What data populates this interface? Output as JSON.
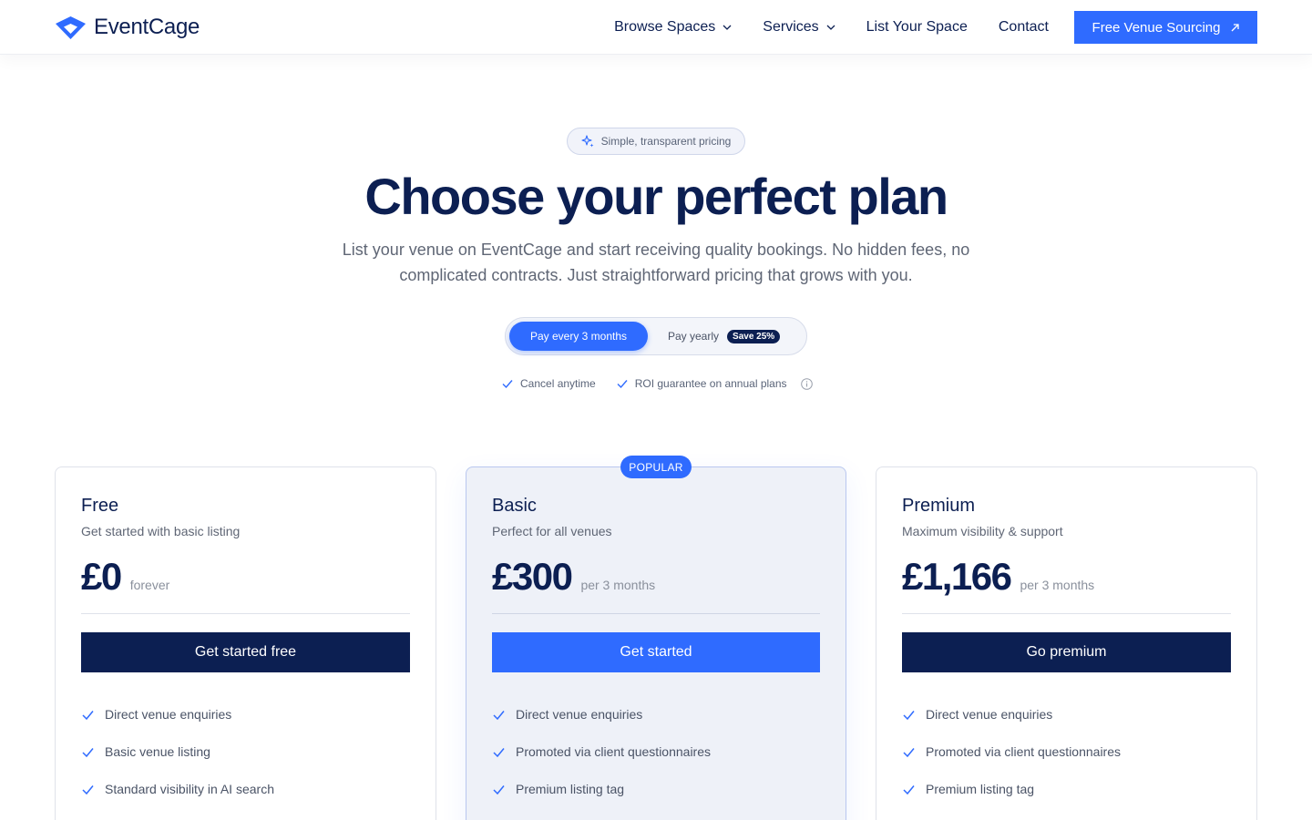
{
  "nav": {
    "brand": "EventCage",
    "items": [
      {
        "label": "Browse Spaces",
        "dropdown": true
      },
      {
        "label": "Services",
        "dropdown": true
      },
      {
        "label": "List Your Space",
        "dropdown": false
      },
      {
        "label": "Contact",
        "dropdown": false
      }
    ],
    "cta_label": "Free Venue Sourcing",
    "cta_icon": "arrow-up-right-icon"
  },
  "hero": {
    "badge": "Simple, transparent pricing",
    "badge_icon": "sparkle-icon",
    "title": "Choose your perfect plan",
    "subtitle": "List your venue on EventCage and start receiving quality bookings. No hidden fees, no complicated contracts. Just straightforward pricing that grows with you."
  },
  "billing": {
    "option_quarterly": "Pay every 3 months",
    "option_yearly": "Pay yearly",
    "save_badge": "Save 25%",
    "selected": "Pay every 3 months"
  },
  "assurances": [
    "Cancel anytime",
    "ROI guarantee on annual plans"
  ],
  "popular_label": "POPULAR",
  "plans": [
    {
      "name": "Free",
      "description": "Get started with basic listing",
      "price": "£0",
      "period": "forever",
      "button": "Get started free",
      "features": [
        "Direct venue enquiries",
        "Basic venue listing",
        "Standard visibility in AI search"
      ]
    },
    {
      "name": "Basic",
      "description": "Perfect for all venues",
      "price": "£300",
      "period": "per 3 months",
      "button": "Get started",
      "features": [
        "Direct venue enquiries",
        "Promoted via client questionnaires",
        "Premium listing tag"
      ]
    },
    {
      "name": "Premium",
      "description": "Maximum visibility & support",
      "price": "£1,166",
      "period": "per 3 months",
      "button": "Go premium",
      "features": [
        "Direct venue enquiries",
        "Promoted via client questionnaires",
        "Premium listing tag"
      ]
    }
  ],
  "colors": {
    "primary": "#2f6bff",
    "navy": "#0c1f52",
    "muted_text": "#5f6675"
  }
}
